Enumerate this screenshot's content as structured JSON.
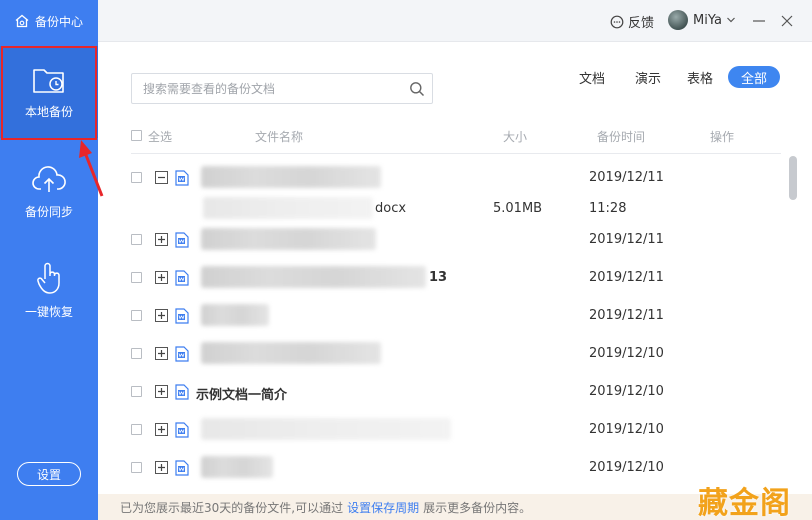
{
  "app": {
    "title": "备份中心"
  },
  "sidebar": {
    "items": [
      {
        "label": "本地备份",
        "icon": "folder-clock-icon"
      },
      {
        "label": "备份同步",
        "icon": "cloud-upload-icon"
      },
      {
        "label": "一键恢复",
        "icon": "hand-pointer-icon"
      }
    ],
    "settings_label": "设置"
  },
  "topbar": {
    "feedback_label": "反馈",
    "username": "MiYa"
  },
  "search": {
    "placeholder": "搜索需要查看的备份文档"
  },
  "filters": {
    "doc": "文档",
    "ppt": "演示",
    "sheet": "表格",
    "all": "全部"
  },
  "table": {
    "headers": {
      "select_all": "全选",
      "name": "文件名称",
      "size": "大小",
      "time": "备份时间",
      "action": "操作"
    },
    "rows": [
      {
        "name": "",
        "time": "2019/12/11"
      },
      {
        "name": "docx",
        "size": "5.01MB",
        "time": "11:28"
      },
      {
        "name": "",
        "time": "2019/12/11"
      },
      {
        "name": "13",
        "time": "2019/12/11"
      },
      {
        "name": "",
        "time": "2019/12/11"
      },
      {
        "name": "",
        "time": "2019/12/10"
      },
      {
        "name": "示例文档一简介",
        "time": "2019/12/10"
      },
      {
        "name": "",
        "time": "2019/12/10"
      },
      {
        "name": "",
        "time": "2019/12/10"
      }
    ]
  },
  "footer": {
    "prefix": "已为您展示最近30天的备份文件,可以通过",
    "link": "设置保存周期",
    "suffix": "展示更多备份内容。"
  },
  "watermark": "藏金阁",
  "colors": {
    "sidebar": "#3e7ef0",
    "accent": "#3e86f0",
    "highlight": "#e8262a",
    "watermark": "#f2a21b"
  }
}
